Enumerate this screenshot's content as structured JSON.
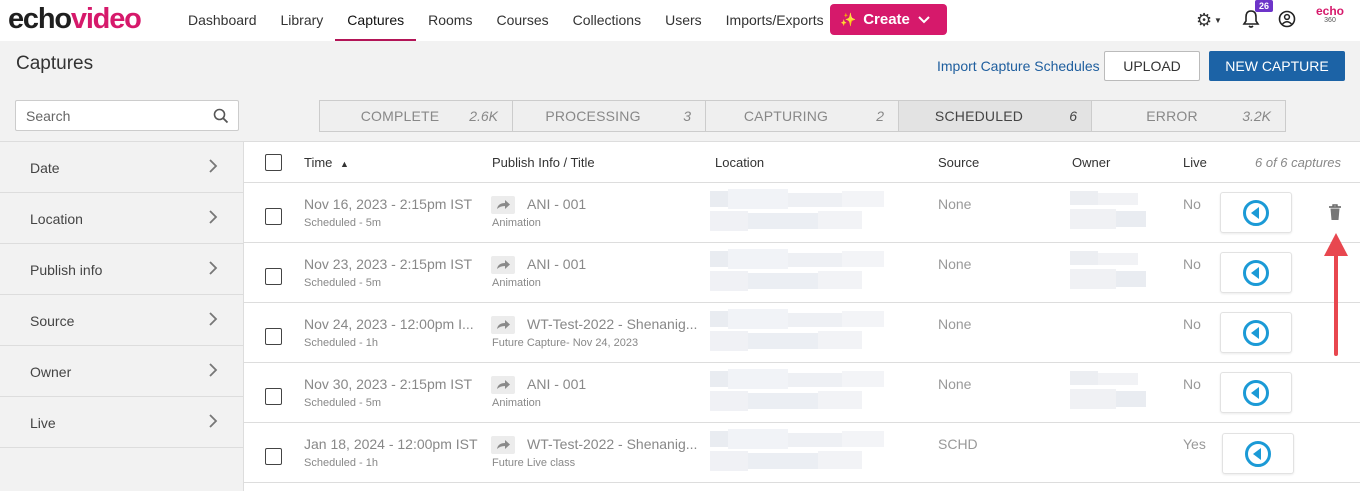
{
  "brand": {
    "logo_echo": "echo",
    "logo_video": "video",
    "accent": "#d6196b",
    "partner_top": "echo",
    "partner_bottom": "360"
  },
  "nav": {
    "items": [
      {
        "label": "Dashboard",
        "active": false
      },
      {
        "label": "Library",
        "active": false
      },
      {
        "label": "Captures",
        "active": true
      },
      {
        "label": "Rooms",
        "active": false
      },
      {
        "label": "Courses",
        "active": false
      },
      {
        "label": "Collections",
        "active": false
      },
      {
        "label": "Users",
        "active": false
      },
      {
        "label": "Imports/Exports",
        "active": false
      }
    ],
    "create_label": "Create",
    "notification_count": "26"
  },
  "header": {
    "title": "Captures",
    "import_link": "Import Capture Schedules",
    "upload_label": "UPLOAD",
    "new_capture_label": "NEW CAPTURE"
  },
  "search": {
    "placeholder": "Search"
  },
  "status_tabs": [
    {
      "label": "COMPLETE",
      "count": "2.6K",
      "active": false
    },
    {
      "label": "PROCESSING",
      "count": "3",
      "active": false
    },
    {
      "label": "CAPTURING",
      "count": "2",
      "active": false
    },
    {
      "label": "SCHEDULED",
      "count": "6",
      "active": true
    },
    {
      "label": "ERROR",
      "count": "3.2K",
      "active": false
    }
  ],
  "filters": [
    {
      "label": "Date"
    },
    {
      "label": "Location"
    },
    {
      "label": "Publish info"
    },
    {
      "label": "Source"
    },
    {
      "label": "Owner"
    },
    {
      "label": "Live"
    }
  ],
  "table": {
    "headers": {
      "time": "Time",
      "title": "Publish Info / Title",
      "location": "Location",
      "source": "Source",
      "owner": "Owner",
      "live": "Live",
      "count": "6 of 6 captures"
    },
    "sort_indicator": "▲",
    "rows": [
      {
        "time": "Nov 16, 2023 - 2:15pm IST",
        "duration": "Scheduled - 5m",
        "title": "ANI - 001",
        "subtitle": "Animation",
        "source": "None",
        "live": "No"
      },
      {
        "time": "Nov 23, 2023 - 2:15pm IST",
        "duration": "Scheduled - 5m",
        "title": "ANI - 001",
        "subtitle": "Animation",
        "source": "None",
        "live": "No"
      },
      {
        "time": "Nov 24, 2023 - 12:00pm I...",
        "duration": "Scheduled - 1h",
        "title": "WT-Test-2022 - Shenanig...",
        "subtitle": "Future Capture- Nov 24, 2023",
        "source": "None",
        "live": "No"
      },
      {
        "time": "Nov 30, 2023 - 2:15pm IST",
        "duration": "Scheduled - 5m",
        "title": "ANI - 001",
        "subtitle": "Animation",
        "source": "None",
        "live": "No"
      },
      {
        "time": "Jan 18, 2024 - 12:00pm IST",
        "duration": "Scheduled - 1h",
        "title": "WT-Test-2022 - Shenanig...",
        "subtitle": "Future Live class",
        "source": "SCHD",
        "live": "Yes"
      }
    ]
  },
  "colors": {
    "primary_blue": "#1c63a6",
    "live_icon": "#1b9ad6",
    "annotation_arrow": "#e8474f"
  }
}
